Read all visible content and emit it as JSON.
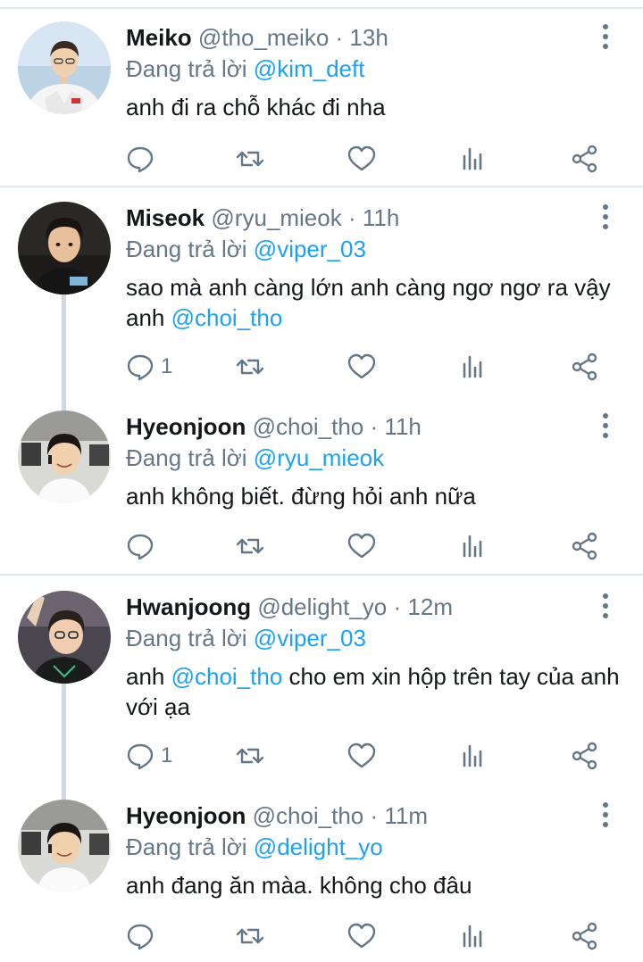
{
  "reply_prefix": "Đang trả lời",
  "tweets": [
    {
      "name": "Meiko",
      "handle": "@tho_meiko",
      "dot": "·",
      "time": "13h",
      "reply_to": "@kim_deft",
      "text_before": "anh đi ra chỗ khác đi nha",
      "text_mention": "",
      "text_after": "",
      "reply_count": "",
      "avatar_desc": "player in white jersey, light blue background"
    },
    {
      "name": "Miseok",
      "handle": "@ryu_mieok",
      "dot": "·",
      "time": "11h",
      "reply_to": "@viper_03",
      "text_before": "sao mà anh càng lớn anh càng ngơ ngơ ra vậy anh ",
      "text_mention": "@choi_tho",
      "text_after": "",
      "reply_count": "1",
      "avatar_desc": "young man with dark hair, dark background"
    },
    {
      "name": "Hyeonjoon",
      "handle": "@choi_tho",
      "dot": "·",
      "time": "11h",
      "reply_to": "@ryu_mieok",
      "text_before": "anh không biết. đừng hỏi anh nữa",
      "text_mention": "",
      "text_after": "",
      "reply_count": "",
      "avatar_desc": "smiling player in white shirt at desk"
    },
    {
      "name": "Hwanjoong",
      "handle": "@delight_yo",
      "dot": "·",
      "time": "12m",
      "reply_to": "@viper_03",
      "text_before": "anh ",
      "text_mention": "@choi_tho",
      "text_after": " cho em xin hộp trên tay của anh với ạa",
      "reply_count": "1",
      "avatar_desc": "player with glasses, dark jersey"
    },
    {
      "name": "Hyeonjoon",
      "handle": "@choi_tho",
      "dot": "·",
      "time": "11m",
      "reply_to": "@delight_yo",
      "text_before": "anh đang ăn màa. không cho đâu",
      "text_mention": "",
      "text_after": "",
      "reply_count": "",
      "avatar_desc": "smiling player in white shirt at desk"
    }
  ],
  "colors": {
    "text": "#14171a",
    "secondary": "#657786",
    "accent": "#1da1f2",
    "divider": "#e1e8ed",
    "thread": "#cfd9de"
  },
  "icons": [
    "reply-icon",
    "retweet-icon",
    "like-icon",
    "analytics-icon",
    "share-icon",
    "more-icon"
  ]
}
